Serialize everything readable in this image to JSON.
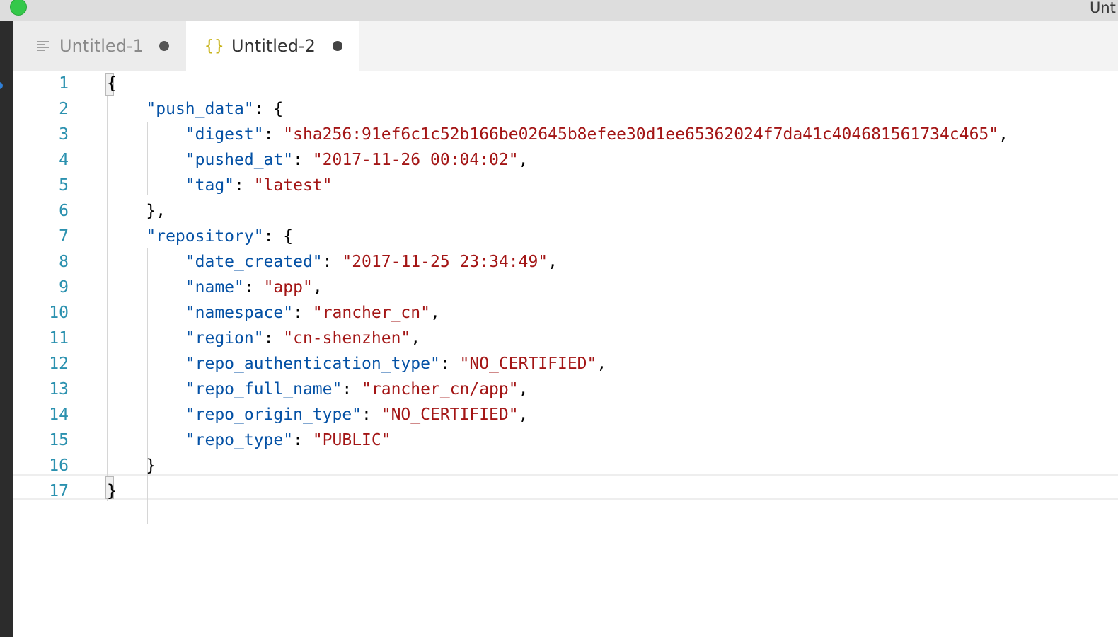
{
  "window": {
    "title": "Unt"
  },
  "tabs": [
    {
      "label": "Untitled-1",
      "icon": "plain-text-icon",
      "active": false,
      "dirty": true
    },
    {
      "label": "Untitled-2",
      "icon": "json-braces-icon",
      "active": true,
      "dirty": true
    }
  ],
  "editor": {
    "language": "json",
    "current_line": 17,
    "lines": [
      {
        "num": "1",
        "indent": "",
        "key": "",
        "sep": "",
        "value": "",
        "tail": "{"
      },
      {
        "num": "2",
        "indent": "    ",
        "key": "\"push_data\"",
        "sep": ": ",
        "value": "",
        "tail": "{"
      },
      {
        "num": "3",
        "indent": "        ",
        "key": "\"digest\"",
        "sep": ": ",
        "value": "\"sha256:91ef6c1c52b166be02645b8efee30d1ee65362024f7da41c404681561734c465\"",
        "tail": ","
      },
      {
        "num": "4",
        "indent": "        ",
        "key": "\"pushed_at\"",
        "sep": ": ",
        "value": "\"2017-11-26 00:04:02\"",
        "tail": ","
      },
      {
        "num": "5",
        "indent": "        ",
        "key": "\"tag\"",
        "sep": ": ",
        "value": "\"latest\"",
        "tail": ""
      },
      {
        "num": "6",
        "indent": "    ",
        "key": "",
        "sep": "",
        "value": "",
        "tail": "},"
      },
      {
        "num": "7",
        "indent": "    ",
        "key": "\"repository\"",
        "sep": ": ",
        "value": "",
        "tail": "{"
      },
      {
        "num": "8",
        "indent": "        ",
        "key": "\"date_created\"",
        "sep": ": ",
        "value": "\"2017-11-25 23:34:49\"",
        "tail": ","
      },
      {
        "num": "9",
        "indent": "        ",
        "key": "\"name\"",
        "sep": ": ",
        "value": "\"app\"",
        "tail": ","
      },
      {
        "num": "10",
        "indent": "        ",
        "key": "\"namespace\"",
        "sep": ": ",
        "value": "\"rancher_cn\"",
        "tail": ","
      },
      {
        "num": "11",
        "indent": "        ",
        "key": "\"region\"",
        "sep": ": ",
        "value": "\"cn-shenzhen\"",
        "tail": ","
      },
      {
        "num": "12",
        "indent": "        ",
        "key": "\"repo_authentication_type\"",
        "sep": ": ",
        "value": "\"NO_CERTIFIED\"",
        "tail": ","
      },
      {
        "num": "13",
        "indent": "        ",
        "key": "\"repo_full_name\"",
        "sep": ": ",
        "value": "\"rancher_cn/app\"",
        "tail": ","
      },
      {
        "num": "14",
        "indent": "        ",
        "key": "\"repo_origin_type\"",
        "sep": ": ",
        "value": "\"NO_CERTIFIED\"",
        "tail": ","
      },
      {
        "num": "15",
        "indent": "        ",
        "key": "\"repo_type\"",
        "sep": ": ",
        "value": "\"PUBLIC\"",
        "tail": ""
      },
      {
        "num": "16",
        "indent": "    ",
        "key": "",
        "sep": "",
        "value": "",
        "tail": "}"
      },
      {
        "num": "17",
        "indent": "",
        "key": "",
        "sep": "",
        "value": "",
        "tail": "}"
      }
    ]
  },
  "colors": {
    "line_number": "#2b91af",
    "json_key": "#0451a5",
    "json_string": "#a31515",
    "punctuation": "#000000",
    "json_icon": "#c9b51e"
  }
}
